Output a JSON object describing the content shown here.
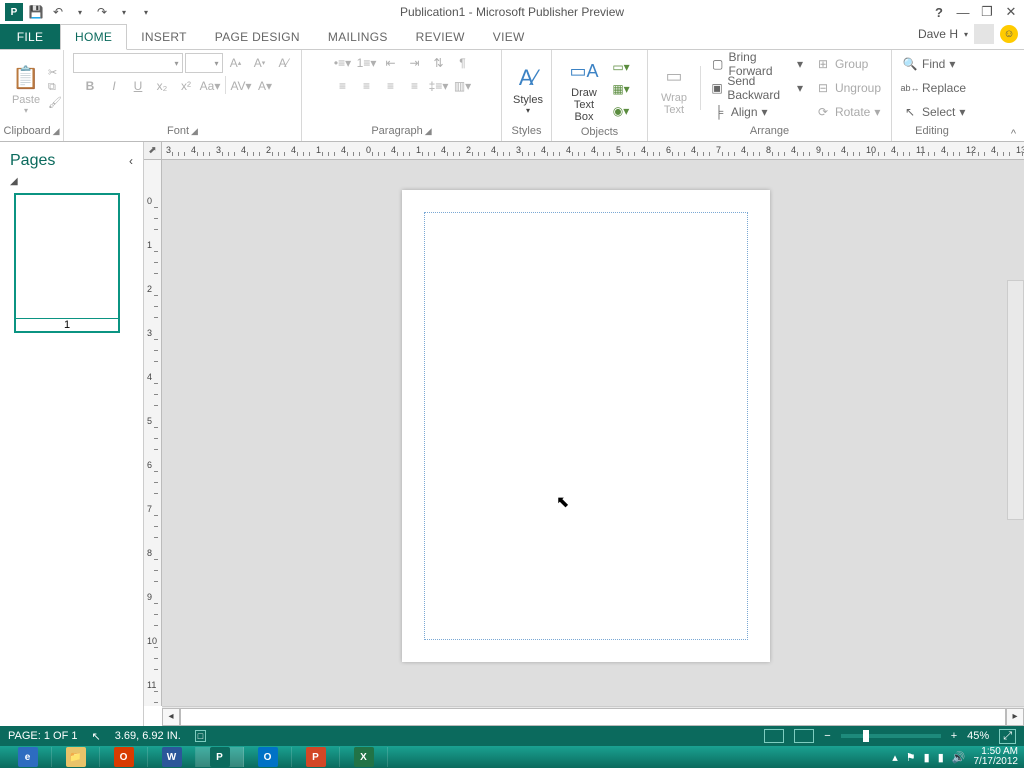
{
  "window": {
    "title": "Publication1 - Microsoft Publisher Preview"
  },
  "user": {
    "name": "Dave H"
  },
  "tabs": {
    "file": "FILE",
    "home": "HOME",
    "insert": "INSERT",
    "pagedesign": "PAGE DESIGN",
    "mailings": "MAILINGS",
    "review": "REVIEW",
    "view": "VIEW"
  },
  "ribbon": {
    "clipboard": {
      "label": "Clipboard",
      "paste": "Paste"
    },
    "font": {
      "label": "Font"
    },
    "paragraph": {
      "label": "Paragraph"
    },
    "styles": {
      "label": "Styles",
      "btn": "Styles"
    },
    "objects": {
      "label": "Objects",
      "drawtb": "Draw\nText Box"
    },
    "arrange": {
      "label": "Arrange",
      "wrap": "Wrap\nText",
      "bringfwd": "Bring Forward",
      "sendback": "Send Backward",
      "align": "Align",
      "group": "Group",
      "ungroup": "Ungroup",
      "rotate": "Rotate"
    },
    "editing": {
      "label": "Editing",
      "find": "Find",
      "replace": "Replace",
      "select": "Select"
    }
  },
  "pages": {
    "title": "Pages",
    "thumb_num": "1"
  },
  "status": {
    "page": "PAGE: 1 OF 1",
    "coords": "3.69, 6.92 IN.",
    "zoom": "45%"
  },
  "taskbar": {
    "time": "1:50 AM",
    "date": "7/17/2012"
  },
  "hruler_ticks": [
    "3",
    "4",
    "3",
    "4",
    "2",
    "4",
    "1",
    "4",
    "0",
    "4",
    "1",
    "4",
    "2",
    "4",
    "3",
    "4",
    "4",
    "4",
    "5",
    "4",
    "6",
    "4",
    "7",
    "4",
    "8",
    "4",
    "9",
    "4",
    "10",
    "4",
    "11",
    "4",
    "12",
    "4",
    "13"
  ],
  "vruler_ticks": [
    "0",
    "1",
    "2",
    "3",
    "4",
    "5",
    "6",
    "7",
    "8",
    "9",
    "10",
    "11"
  ]
}
